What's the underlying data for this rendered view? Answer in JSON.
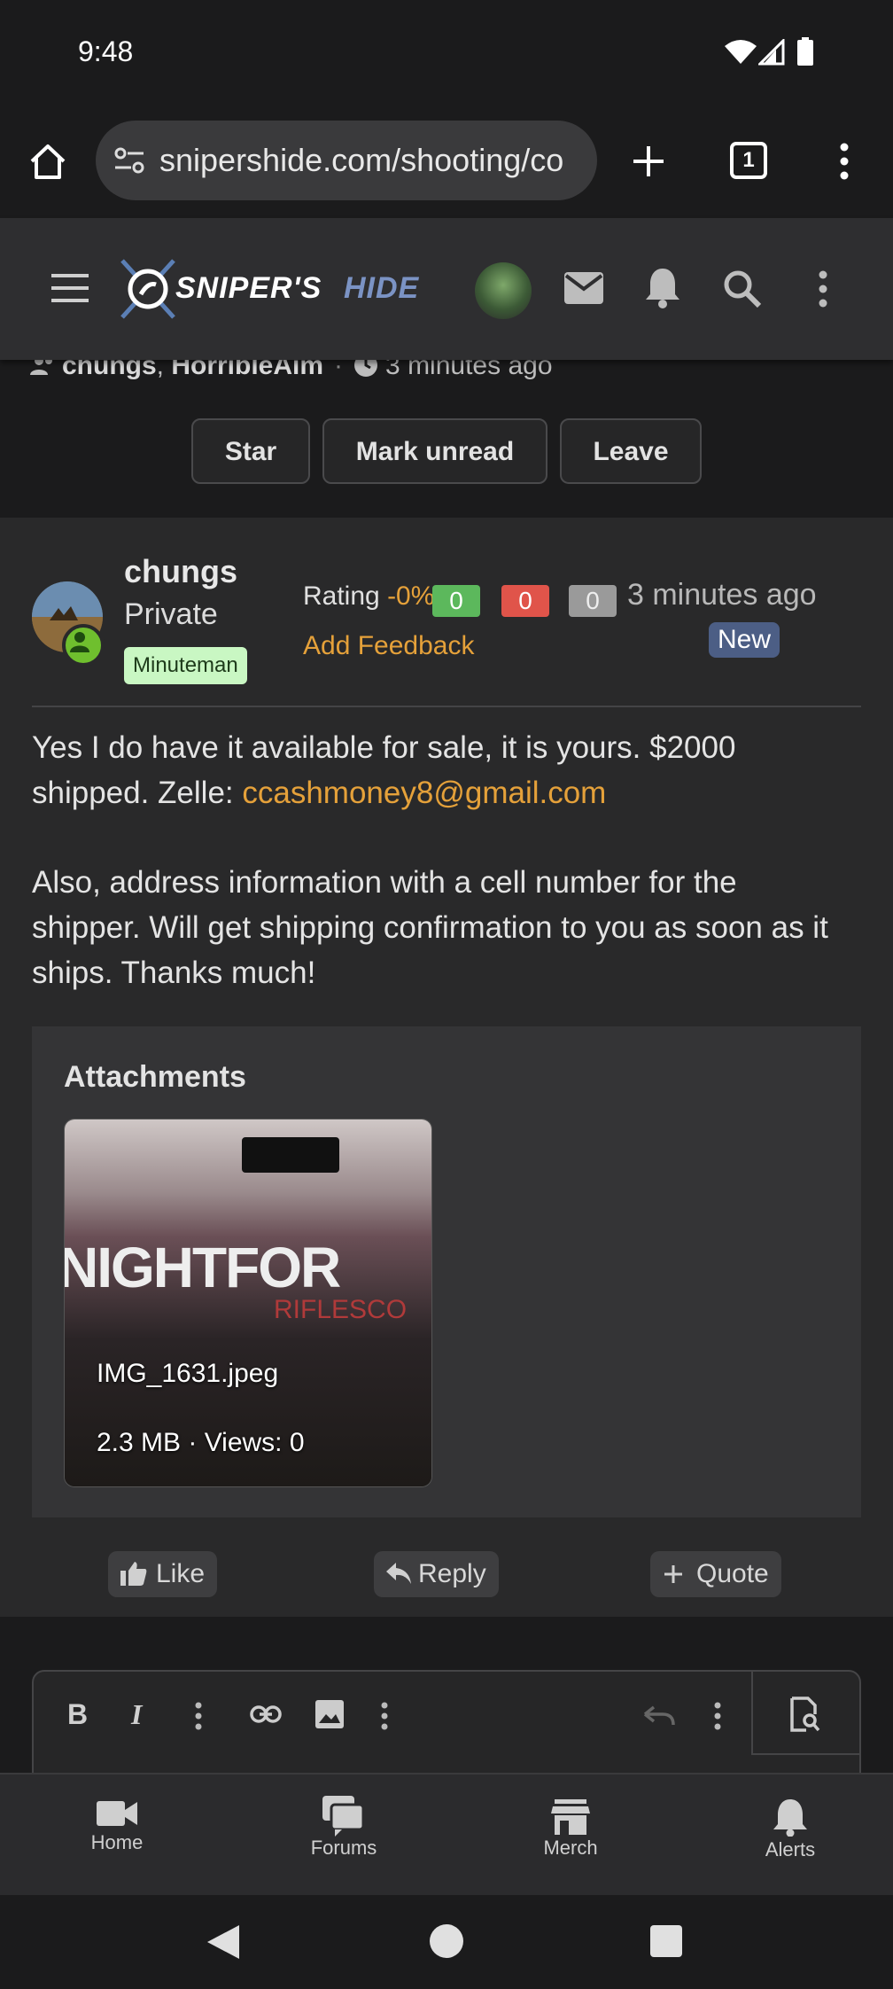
{
  "status_bar": {
    "time": "9:48"
  },
  "browser": {
    "url": "snipershide.com/shooting/co",
    "tab_count": "1"
  },
  "site": {
    "logo_part1": "SNIPER'S",
    "logo_part2": "HIDE"
  },
  "thread": {
    "participants_a": "chungs",
    "participants_sep": ", ",
    "participants_b": "HorribleAim",
    "meta_sep": "·",
    "time": "3 minutes ago",
    "buttons": {
      "star": "Star",
      "mark_unread": "Mark unread",
      "leave": "Leave"
    }
  },
  "post": {
    "username": "chungs",
    "user_title": "Private",
    "user_banner": "Minuteman",
    "rating_label": "Rating",
    "rating_value": "-0%",
    "rating_positive": "0",
    "rating_negative": "0",
    "rating_neutral": "0",
    "add_feedback": "Add Feedback",
    "time": "3 minutes ago",
    "new_badge": "New",
    "body_line1": "Yes I do have it available for sale, it is yours. $2000",
    "body_line2_prefix": "shipped. Zelle: ",
    "email": "ccashmoney8@gmail.com",
    "body_para2_line1": "Also, address information with a cell number for the",
    "body_para2_line2": "shipper. Will get shipping confirmation to you as soon as it",
    "body_para2_line3": "ships. Thanks much!",
    "attachments_title": "Attachments",
    "attachment": {
      "image_text": "NIGHTFOR",
      "image_subtext": "RIFLESCO",
      "filename": "IMG_1631.jpeg",
      "meta": "2.3 MB · Views: 0"
    },
    "actions": {
      "like": "Like",
      "reply": "Reply",
      "quote": "Quote"
    }
  },
  "bottom_nav": {
    "items": [
      {
        "label": "Home",
        "icon": "video-camera-icon"
      },
      {
        "label": "Forums",
        "icon": "chat-bubbles-icon"
      },
      {
        "label": "Merch",
        "icon": "store-icon"
      },
      {
        "label": "Alerts",
        "icon": "bell-icon"
      }
    ]
  },
  "colors": {
    "accent": "#e5a13a",
    "rating_positive": "#5cb85c",
    "rating_negative": "#e0544a",
    "rating_neutral": "#9a9a9a",
    "new_badge": "#4c5e85",
    "banner": "#c9f7c3"
  }
}
